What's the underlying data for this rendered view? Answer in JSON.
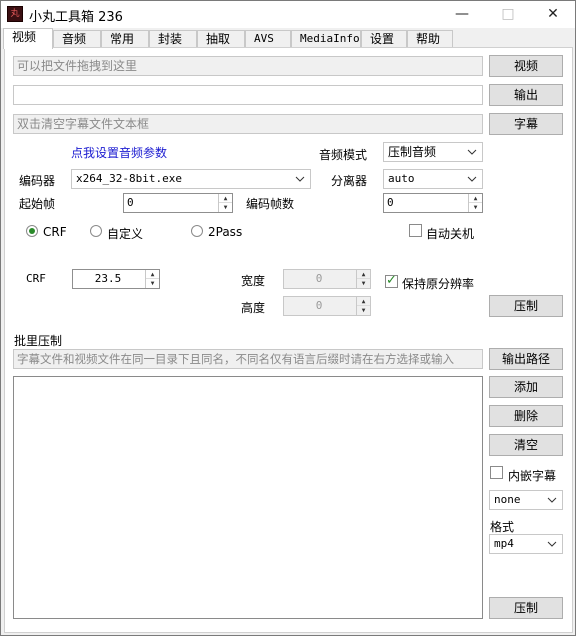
{
  "window": {
    "title": "小丸工具箱 236",
    "app_icon_text": "丸",
    "minimize_glyph": "—",
    "maximize_glyph": "□",
    "close_glyph": "✕"
  },
  "tabs": [
    "视频",
    "音频",
    "常用",
    "封装",
    "抽取",
    "AVS",
    "MediaInfo",
    "设置",
    "帮助"
  ],
  "video": {
    "video_file_placeholder": "可以把文件拖拽到这里",
    "output_file_value": "",
    "subtitle_placeholder": "双击清空字幕文件文本框",
    "video_button": "视频",
    "output_button": "输出",
    "subtitle_button": "字幕",
    "audio_params_link": "点我设置音频参数",
    "audio_mode_label": "音频模式",
    "audio_mode_value": "压制音频",
    "encoder_label": "编码器",
    "encoder_value": "x264_32-8bit.exe",
    "demuxer_label": "分离器",
    "demuxer_value": "auto",
    "start_frame_label": "起始帧",
    "start_frame_value": "0",
    "encode_frames_label": "编码帧数",
    "encode_frames_value": "0",
    "mode_crf": "CRF",
    "mode_custom": "自定义",
    "mode_2pass": "2Pass",
    "auto_shutdown": "自动关机",
    "crf_label": "CRF",
    "crf_value": "23.5",
    "width_label": "宽度",
    "width_value": "0",
    "height_label": "高度",
    "height_value": "0",
    "keep_resolution": "保持原分辨率",
    "encode_button": "压制"
  },
  "batch": {
    "section_title": "批里压制",
    "hint_placeholder": "字幕文件和视频文件在同一目录下且同名，不同名仅有语言后缀时请在右方选择或输入",
    "output_path_button": "输出路径",
    "add_button": "添加",
    "delete_button": "删除",
    "clear_button": "清空",
    "embed_subtitle": "内嵌字幕",
    "subtitle_lang_value": "none",
    "format_label": "格式",
    "format_value": "mp4",
    "encode_button": "压制"
  }
}
